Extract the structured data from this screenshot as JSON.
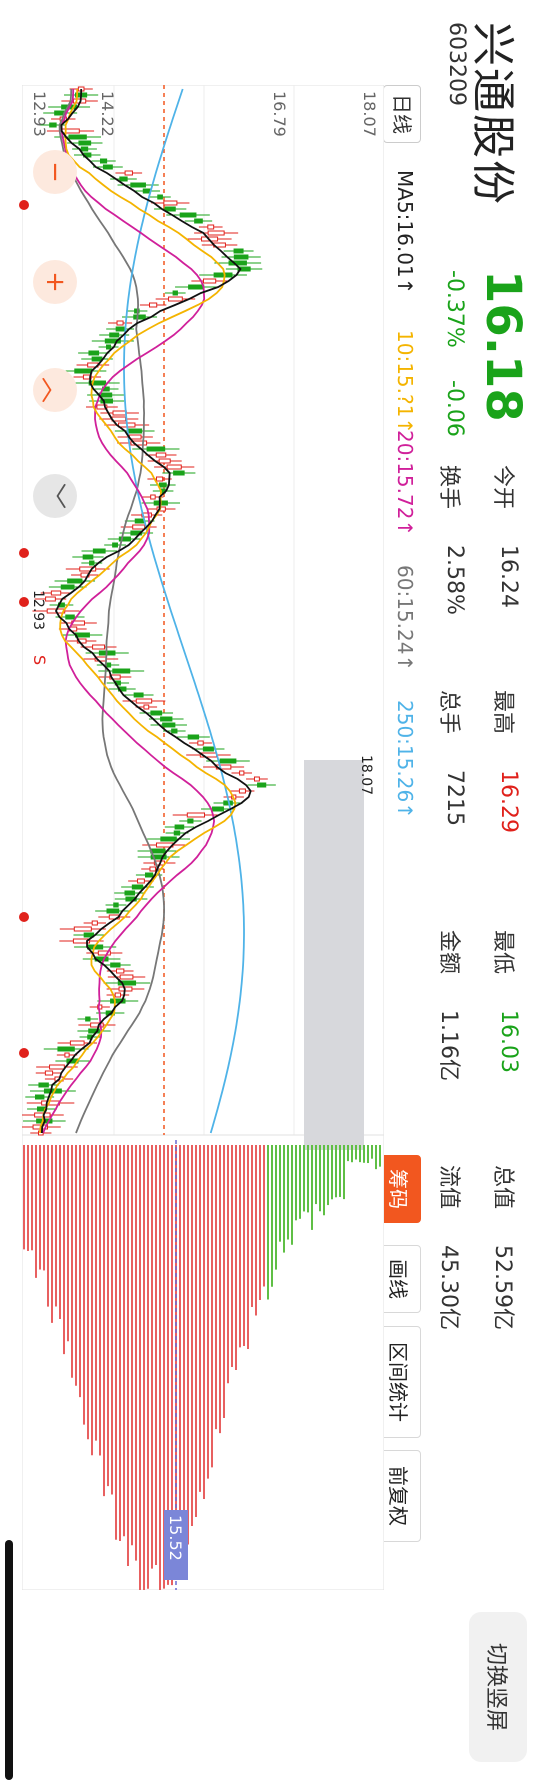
{
  "header": {
    "name": "兴通股份",
    "code": "603209",
    "price": "16.18",
    "change_pct": "-0.37%",
    "change_abs": "-0.06",
    "stats": [
      {
        "label": "今开",
        "value": "16.24",
        "color": "#222222"
      },
      {
        "label": "换手",
        "value": "2.58%",
        "color": "#222222"
      },
      {
        "label": "最高",
        "value": "16.29",
        "color": "#e0211b"
      },
      {
        "label": "总手",
        "value": "7215",
        "color": "#222222"
      },
      {
        "label": "最低",
        "value": "16.03",
        "color": "#1aa31a"
      },
      {
        "label": "金额",
        "value": "1.16亿",
        "color": "#222222"
      },
      {
        "label": "总值",
        "value": "52.59亿",
        "color": "#222222"
      },
      {
        "label": "流值",
        "value": "45.30亿",
        "color": "#222222"
      }
    ],
    "switch_label": "切换竖屏"
  },
  "tabs": [
    "筹码",
    "画线",
    "区间统计",
    "前复权"
  ],
  "ma_labels": [
    {
      "text": "日线",
      "color": "#333333"
    },
    {
      "text": "MA5:16.01↑",
      "color": "#222222"
    },
    {
      "text": "10:15.?1↑",
      "color": "#f4b400"
    },
    {
      "text": "20:15.72↑",
      "color": "#d0209a"
    },
    {
      "text": "60:15.24↑",
      "color": "#777777"
    },
    {
      "text": "250:15.26↑",
      "color": "#4fb3e8"
    }
  ],
  "price_axis": [
    "18.07",
    "16.79",
    "14.22",
    "12.93"
  ],
  "annotations": {
    "high_marker": "18.07",
    "low_marker": "12.93",
    "chip_price": "15.52",
    "sell_flag": "S"
  },
  "colors": {
    "up": "#e0211b",
    "down": "#1aa31a",
    "accent": "#f2571f",
    "ma5": "#111111",
    "ma10": "#f4b400",
    "ma20": "#d0209a",
    "ma60": "#777777",
    "ma250": "#4fb3e8"
  },
  "icons": [
    "minus-icon",
    "plus-icon",
    "chevron-up-icon",
    "chevron-down-icon",
    "expand-icon"
  ]
}
